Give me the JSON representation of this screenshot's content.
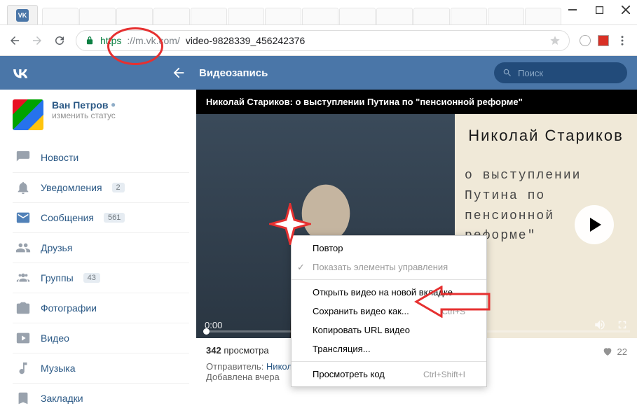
{
  "browser": {
    "url_protocol": "https",
    "url_host": "://m.vk.com/",
    "url_path": "video-9828339_456242376"
  },
  "vk_header": {
    "title": "Видеозапись",
    "search_placeholder": "Поиск"
  },
  "profile": {
    "name": "Ван Петров",
    "status": "изменить статус"
  },
  "nav": {
    "items": [
      {
        "label": "Новости"
      },
      {
        "label": "Уведомления",
        "badge": "2"
      },
      {
        "label": "Сообщения",
        "badge": "561"
      },
      {
        "label": "Друзья"
      },
      {
        "label": "Группы",
        "badge": "43"
      },
      {
        "label": "Фотографии"
      },
      {
        "label": "Видео"
      },
      {
        "label": "Музыка"
      },
      {
        "label": "Закладки"
      }
    ]
  },
  "video": {
    "caption": "Николай Стариков: о выступлении Путина по \"пенсионной реформе\"",
    "overlay_title": "Николай Стариков",
    "overlay_sub": "о выступлении Путина по пенсионной реформе\"",
    "time": "0:00",
    "views_num": "342",
    "views_label": " просмотра",
    "likes": "22",
    "sender_label": "Отправитель: ",
    "sender_name": "Николай Стариков (официальная страница)",
    "added": "Добавлена вчера"
  },
  "context_menu": {
    "items": [
      {
        "label": "Повтор"
      },
      {
        "label": "Показать элементы управления",
        "checked": true,
        "disabled": true
      },
      {
        "sep": true
      },
      {
        "label": "Открыть видео на новой вкладке"
      },
      {
        "label": "Сохранить видео как...",
        "shortcut": "Ctrl+S"
      },
      {
        "label": "Копировать URL видео"
      },
      {
        "label": "Трансляция..."
      },
      {
        "sep": true
      },
      {
        "label": "Просмотреть код",
        "shortcut": "Ctrl+Shift+I"
      }
    ]
  }
}
